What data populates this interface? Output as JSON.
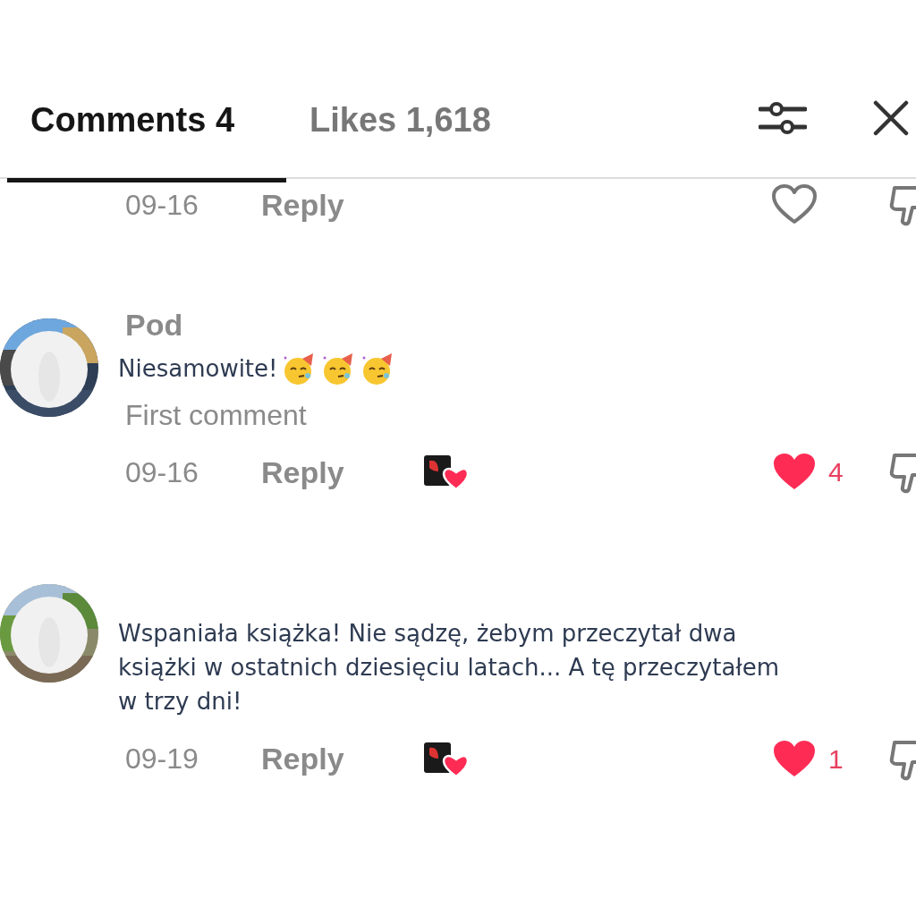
{
  "tabs": [
    {
      "label": "Comments 4",
      "selected": true
    },
    {
      "label": "Likes 1,618",
      "selected": false
    }
  ],
  "partial_row": {
    "date": "09-16",
    "reply": "Reply",
    "liked": false
  },
  "comments": [
    {
      "name": "Pod",
      "text": "Niesamowite!",
      "emojis": [
        {
          "kind": "party"
        },
        {
          "kind": "party"
        },
        {
          "kind": "party"
        }
      ],
      "label": "First comment",
      "date": "09-16",
      "reply": "Reply",
      "creator_liked": true,
      "liked": true,
      "likes": "4"
    },
    {
      "text": "Wspaniała książka! Nie sądzę, żebym przeczytał dwa książki w ostatnich dziesięciu latach... A tę przeczytałem w trzy dni!",
      "date": "09-19",
      "reply": "Reply",
      "creator_liked": true,
      "liked": true,
      "likes": "1"
    }
  ]
}
